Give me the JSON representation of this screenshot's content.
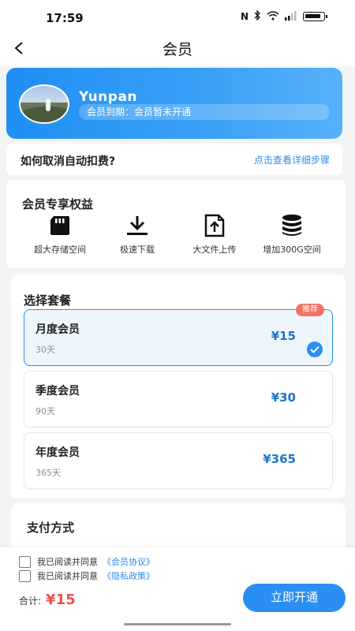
{
  "status_bar": {
    "time": "17:59"
  },
  "nav": {
    "title": "会员"
  },
  "member": {
    "username": "Yunpan",
    "expiry_text": "会员到期：会员暂未开通"
  },
  "cancel": {
    "title": "如何取消自动扣费?",
    "link": "点击查看详细步骤"
  },
  "benefits": {
    "title": "会员专享权益",
    "items": [
      {
        "label": "超大存储空间",
        "icon": "sd-card-icon"
      },
      {
        "label": "极速下载",
        "icon": "download-icon"
      },
      {
        "label": "大文件上传",
        "icon": "upload-file-icon"
      },
      {
        "label": "增加300G空间",
        "icon": "database-icon"
      }
    ]
  },
  "plans": {
    "title": "选择套餐",
    "items": [
      {
        "name": "月度会员",
        "sub": "30天",
        "price": "¥15",
        "badge": "推荐",
        "selected": true
      },
      {
        "name": "季度会员",
        "sub": "90天",
        "price": "¥30",
        "selected": false
      },
      {
        "name": "年度会员",
        "sub": "365天",
        "price": "¥365",
        "selected": false
      }
    ]
  },
  "payment": {
    "title": "支付方式"
  },
  "agreements": [
    {
      "text": "我已阅读并同意",
      "link": "《会员协议》"
    },
    {
      "text": "我已阅读并同意",
      "link": "《隐私政策》"
    }
  ],
  "footer": {
    "total_label": "合计:",
    "total_value": "¥15",
    "pay_button": "立即开通"
  },
  "colors": {
    "accent": "#2b8ef2",
    "price": "#1f74c6",
    "total": "#f24f4f",
    "badge": "#f27263"
  }
}
